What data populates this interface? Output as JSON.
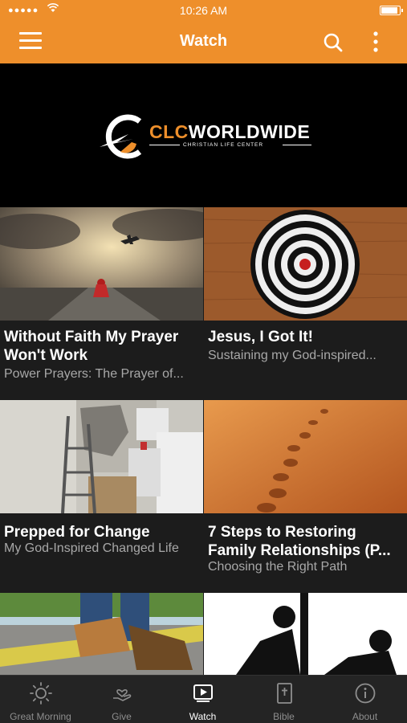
{
  "status_bar": {
    "time": "10:26 AM",
    "signal": "●●●●●"
  },
  "header": {
    "title": "Watch"
  },
  "banner": {
    "brand_prefix": "CLC",
    "brand_main": "WORLDWIDE",
    "brand_sub": "CHRISTIAN LIFE CENTER"
  },
  "videos": [
    {
      "title": "Without Faith My Prayer Won't Work",
      "subtitle": "Power Prayers: The Prayer of..."
    },
    {
      "title": "Jesus, I Got It!",
      "subtitle": "Sustaining my God-inspired..."
    },
    {
      "title": "Prepped for Change",
      "subtitle": "My God-Inspired Changed Life"
    },
    {
      "title": "7 Steps to Restoring Family Relationships (P...",
      "subtitle": "Choosing the Right Path"
    }
  ],
  "tabs": [
    {
      "label": "Great Morning",
      "icon": "sun-icon"
    },
    {
      "label": "Give",
      "icon": "give-hand-heart-icon"
    },
    {
      "label": "Watch",
      "icon": "video-play-icon",
      "active": true
    },
    {
      "label": "Bible",
      "icon": "bible-book-icon"
    },
    {
      "label": "About",
      "icon": "info-icon"
    }
  ],
  "colors": {
    "brand_orange": "#ee8f2b",
    "background": "#1c1c1c",
    "subtitle": "#a8a8a8"
  }
}
